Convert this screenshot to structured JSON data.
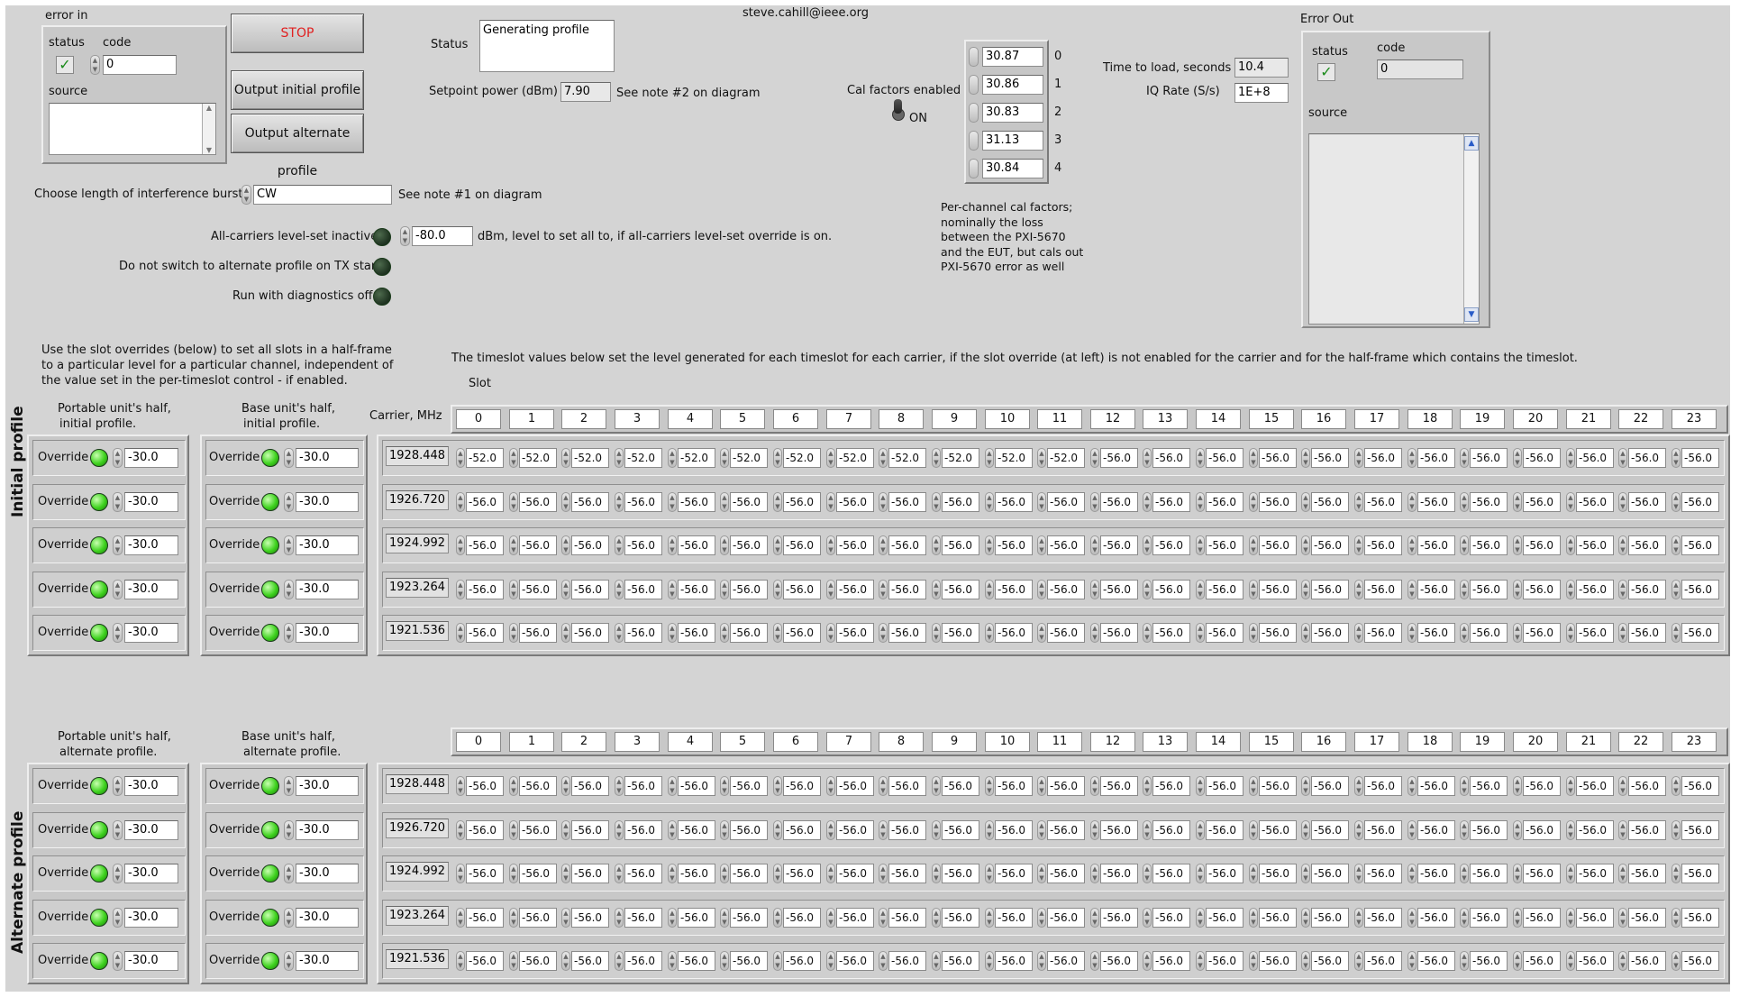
{
  "error_in": {
    "title": "error in",
    "status_label": "status",
    "code_label": "code",
    "code_value": "0",
    "source_label": "source",
    "status_icon": "checkmark-icon"
  },
  "buttons": {
    "stop": "STOP",
    "output_initial": "Output initial profile",
    "output_alternate": "Output alternate profile"
  },
  "status": {
    "label": "Status",
    "value": "Generating profile"
  },
  "setpoint": {
    "label": "Setpoint power (dBm)",
    "value": "7.90",
    "note": "See note #2 on diagram"
  },
  "email": "steve.cahill@ieee.org",
  "cal": {
    "label": "Cal factors enabled",
    "switch_label": "ON",
    "values": [
      "30.87",
      "30.86",
      "30.83",
      "31.13",
      "30.84"
    ],
    "indices": [
      "0",
      "1",
      "2",
      "3",
      "4"
    ],
    "note": [
      "Per-channel cal factors;",
      "nominally the loss",
      "between the PXI-5670",
      "and the EUT, but cals out",
      "PXI-5670 error as well"
    ]
  },
  "timing": {
    "load_label": "Time to load, seconds",
    "load_value": "10.4",
    "iq_label": "IQ Rate (S/s)",
    "iq_value": "1E+8"
  },
  "error_out": {
    "title": "Error Out",
    "status_label": "status",
    "code_label": "code",
    "code_value": "0",
    "source_label": "source",
    "status_icon": "checkmark-icon"
  },
  "burst": {
    "label": "Choose length of interference burst",
    "value": "CW",
    "note": "See note  #1 on diagram"
  },
  "options": {
    "all_carriers_label": "All-carriers level-set inactive",
    "all_carriers_value": "-80.0",
    "all_carriers_note": "dBm, level to set all to, if all-carriers level-set override is on.",
    "no_switch_label": "Do not switch to alternate profile on TX start",
    "diag_label": "Run with diagnostics off"
  },
  "override_note": [
    "Use the slot overrides (below) to set all slots in a half-frame",
    "to a particular level for a particular channel, independent of",
    "the value set in the per-timeslot control - if enabled."
  ],
  "timeslot_note": "The timeslot values below set the level generated for each timeslot for each carrier, if the slot override (at left)  is not enabled for the carrier and for the half-frame which contains the timeslot.",
  "slot_label": "Slot",
  "carrier_label": "Carrier, MHz",
  "slots": [
    "0",
    "1",
    "2",
    "3",
    "4",
    "5",
    "6",
    "7",
    "8",
    "9",
    "10",
    "11",
    "12",
    "13",
    "14",
    "15",
    "16",
    "17",
    "18",
    "19",
    "20",
    "21",
    "22",
    "23"
  ],
  "initial_profile": {
    "side_label": "Initial profile",
    "portable_label": [
      "Portable unit's half,",
      "initial profile."
    ],
    "base_label": [
      "Base unit's half,",
      "initial profile."
    ],
    "override_label": "Override",
    "portable_values": [
      "-30.0",
      "-30.0",
      "-30.0",
      "-30.0",
      "-30.0"
    ],
    "base_values": [
      "-30.0",
      "-30.0",
      "-30.0",
      "-30.0",
      "-30.0"
    ],
    "carriers": [
      "1928.448",
      "1926.720",
      "1924.992",
      "1923.264",
      "1921.536"
    ],
    "grid": [
      [
        "-52.0",
        "-52.0",
        "-52.0",
        "-52.0",
        "-52.0",
        "-52.0",
        "-52.0",
        "-52.0",
        "-52.0",
        "-52.0",
        "-52.0",
        "-52.0",
        "-56.0",
        "-56.0",
        "-56.0",
        "-56.0",
        "-56.0",
        "-56.0",
        "-56.0",
        "-56.0",
        "-56.0",
        "-56.0",
        "-56.0",
        "-56.0"
      ],
      [
        "-56.0",
        "-56.0",
        "-56.0",
        "-56.0",
        "-56.0",
        "-56.0",
        "-56.0",
        "-56.0",
        "-56.0",
        "-56.0",
        "-56.0",
        "-56.0",
        "-56.0",
        "-56.0",
        "-56.0",
        "-56.0",
        "-56.0",
        "-56.0",
        "-56.0",
        "-56.0",
        "-56.0",
        "-56.0",
        "-56.0",
        "-56.0"
      ],
      [
        "-56.0",
        "-56.0",
        "-56.0",
        "-56.0",
        "-56.0",
        "-56.0",
        "-56.0",
        "-56.0",
        "-56.0",
        "-56.0",
        "-56.0",
        "-56.0",
        "-56.0",
        "-56.0",
        "-56.0",
        "-56.0",
        "-56.0",
        "-56.0",
        "-56.0",
        "-56.0",
        "-56.0",
        "-56.0",
        "-56.0",
        "-56.0"
      ],
      [
        "-56.0",
        "-56.0",
        "-56.0",
        "-56.0",
        "-56.0",
        "-56.0",
        "-56.0",
        "-56.0",
        "-56.0",
        "-56.0",
        "-56.0",
        "-56.0",
        "-56.0",
        "-56.0",
        "-56.0",
        "-56.0",
        "-56.0",
        "-56.0",
        "-56.0",
        "-56.0",
        "-56.0",
        "-56.0",
        "-56.0",
        "-56.0"
      ],
      [
        "-56.0",
        "-56.0",
        "-56.0",
        "-56.0",
        "-56.0",
        "-56.0",
        "-56.0",
        "-56.0",
        "-56.0",
        "-56.0",
        "-56.0",
        "-56.0",
        "-56.0",
        "-56.0",
        "-56.0",
        "-56.0",
        "-56.0",
        "-56.0",
        "-56.0",
        "-56.0",
        "-56.0",
        "-56.0",
        "-56.0",
        "-56.0"
      ]
    ]
  },
  "alternate_profile": {
    "side_label": "Alternate profile",
    "portable_label": [
      "Portable unit's half,",
      "alternate profile."
    ],
    "base_label": [
      "Base unit's half,",
      "alternate profile."
    ],
    "override_label": "Override",
    "portable_values": [
      "-30.0",
      "-30.0",
      "-30.0",
      "-30.0",
      "-30.0"
    ],
    "base_values": [
      "-30.0",
      "-30.0",
      "-30.0",
      "-30.0",
      "-30.0"
    ],
    "carriers": [
      "1928.448",
      "1926.720",
      "1924.992",
      "1923.264",
      "1921.536"
    ],
    "grid": [
      [
        "-56.0",
        "-56.0",
        "-56.0",
        "-56.0",
        "-56.0",
        "-56.0",
        "-56.0",
        "-56.0",
        "-56.0",
        "-56.0",
        "-56.0",
        "-56.0",
        "-56.0",
        "-56.0",
        "-56.0",
        "-56.0",
        "-56.0",
        "-56.0",
        "-56.0",
        "-56.0",
        "-56.0",
        "-56.0",
        "-56.0",
        "-56.0"
      ],
      [
        "-56.0",
        "-56.0",
        "-56.0",
        "-56.0",
        "-56.0",
        "-56.0",
        "-56.0",
        "-56.0",
        "-56.0",
        "-56.0",
        "-56.0",
        "-56.0",
        "-56.0",
        "-56.0",
        "-56.0",
        "-56.0",
        "-56.0",
        "-56.0",
        "-56.0",
        "-56.0",
        "-56.0",
        "-56.0",
        "-56.0",
        "-56.0"
      ],
      [
        "-56.0",
        "-56.0",
        "-56.0",
        "-56.0",
        "-56.0",
        "-56.0",
        "-56.0",
        "-56.0",
        "-56.0",
        "-56.0",
        "-56.0",
        "-56.0",
        "-56.0",
        "-56.0",
        "-56.0",
        "-56.0",
        "-56.0",
        "-56.0",
        "-56.0",
        "-56.0",
        "-56.0",
        "-56.0",
        "-56.0",
        "-56.0"
      ],
      [
        "-56.0",
        "-56.0",
        "-56.0",
        "-56.0",
        "-56.0",
        "-56.0",
        "-56.0",
        "-56.0",
        "-56.0",
        "-56.0",
        "-56.0",
        "-56.0",
        "-56.0",
        "-56.0",
        "-56.0",
        "-56.0",
        "-56.0",
        "-56.0",
        "-56.0",
        "-56.0",
        "-56.0",
        "-56.0",
        "-56.0",
        "-56.0"
      ],
      [
        "-56.0",
        "-56.0",
        "-56.0",
        "-56.0",
        "-56.0",
        "-56.0",
        "-56.0",
        "-56.0",
        "-56.0",
        "-56.0",
        "-56.0",
        "-56.0",
        "-56.0",
        "-56.0",
        "-56.0",
        "-56.0",
        "-56.0",
        "-56.0",
        "-56.0",
        "-56.0",
        "-56.0",
        "-56.0",
        "-56.0",
        "-56.0"
      ]
    ]
  }
}
